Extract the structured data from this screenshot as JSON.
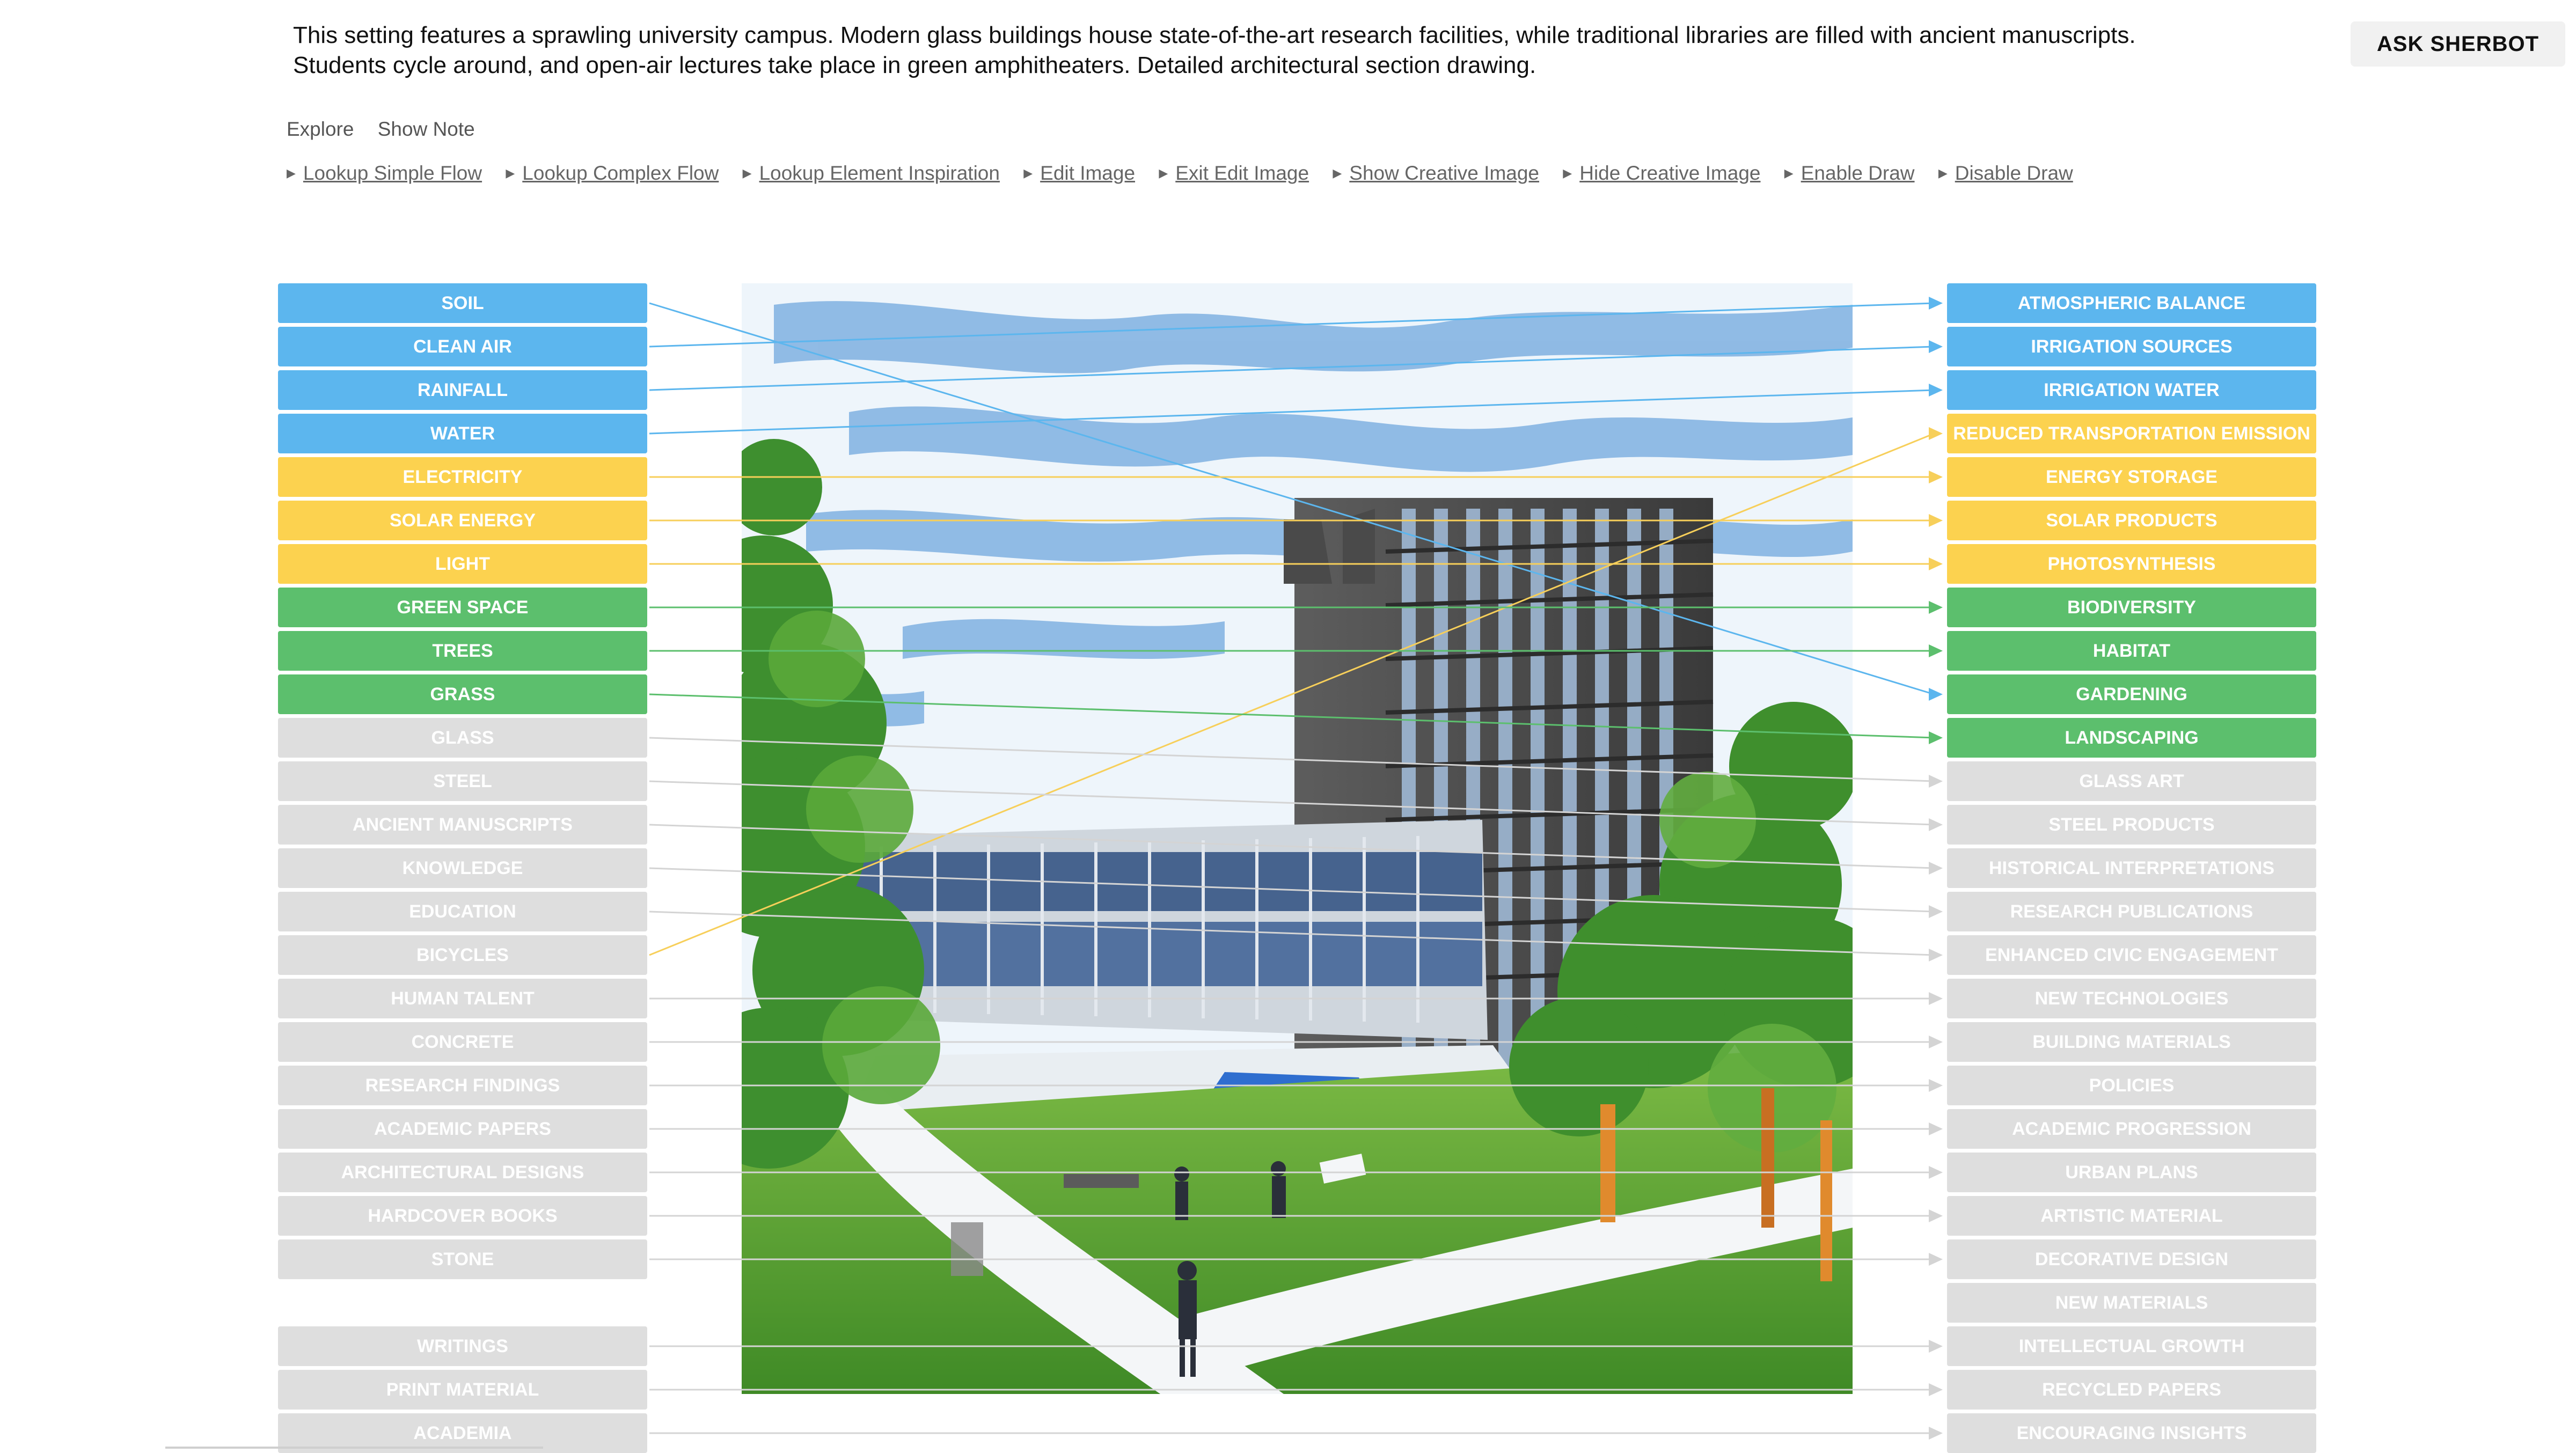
{
  "description": "This setting features a sprawling university campus. Modern glass buildings house state-of-the-art research facilities, while traditional libraries are filled with ancient manuscripts. Students cycle around, and open-air lectures take place in green amphitheaters. Detailed architectural section drawing.",
  "ask_button": "ASK SHERBOT",
  "tabs": [
    "Explore",
    "Show Note"
  ],
  "actions": [
    "Lookup Simple Flow",
    "Lookup Complex Flow",
    "Lookup Element Inspiration",
    "Edit Image",
    "Exit Edit Image",
    "Show Creative Image",
    "Hide Creative Image",
    "Enable Draw",
    "Disable Draw"
  ],
  "colors": {
    "blue": "#5cb6ee",
    "yellow": "#fcd24f",
    "green": "#5cbf6d",
    "gray": "#dedede"
  },
  "inputs": [
    {
      "label": "SOIL",
      "color": "blue"
    },
    {
      "label": "CLEAN AIR",
      "color": "blue"
    },
    {
      "label": "RAINFALL",
      "color": "blue"
    },
    {
      "label": "WATER",
      "color": "blue"
    },
    {
      "label": "ELECTRICITY",
      "color": "yellow"
    },
    {
      "label": "SOLAR ENERGY",
      "color": "yellow"
    },
    {
      "label": "LIGHT",
      "color": "yellow"
    },
    {
      "label": "GREEN SPACE",
      "color": "green"
    },
    {
      "label": "TREES",
      "color": "green"
    },
    {
      "label": "GRASS",
      "color": "green"
    },
    {
      "label": "GLASS",
      "color": "gray"
    },
    {
      "label": "STEEL",
      "color": "gray"
    },
    {
      "label": "ANCIENT MANUSCRIPTS",
      "color": "gray"
    },
    {
      "label": "KNOWLEDGE",
      "color": "gray"
    },
    {
      "label": "EDUCATION",
      "color": "gray"
    },
    {
      "label": "BICYCLES",
      "color": "gray"
    },
    {
      "label": "HUMAN TALENT",
      "color": "gray"
    },
    {
      "label": "CONCRETE",
      "color": "gray"
    },
    {
      "label": "RESEARCH FINDINGS",
      "color": "gray"
    },
    {
      "label": "ACADEMIC PAPERS",
      "color": "gray"
    },
    {
      "label": "ARCHITECTURAL DESIGNS",
      "color": "gray"
    },
    {
      "label": "HARDCOVER BOOKS",
      "color": "gray"
    },
    {
      "label": "STONE",
      "color": "gray"
    },
    {
      "label": "WRITINGS",
      "color": "gray"
    },
    {
      "label": "PRINT MATERIAL",
      "color": "gray"
    },
    {
      "label": "ACADEMIA",
      "color": "gray"
    }
  ],
  "outputs": [
    {
      "label": "ATMOSPHERIC BALANCE",
      "color": "blue"
    },
    {
      "label": "IRRIGATION SOURCES",
      "color": "blue"
    },
    {
      "label": "IRRIGATION WATER",
      "color": "blue"
    },
    {
      "label": "REDUCED TRANSPORTATION EMISSION",
      "color": "yellow"
    },
    {
      "label": "ENERGY STORAGE",
      "color": "yellow"
    },
    {
      "label": "SOLAR PRODUCTS",
      "color": "yellow"
    },
    {
      "label": "PHOTOSYNTHESIS",
      "color": "yellow"
    },
    {
      "label": "BIODIVERSITY",
      "color": "green"
    },
    {
      "label": "HABITAT",
      "color": "green"
    },
    {
      "label": "GARDENING",
      "color": "green"
    },
    {
      "label": "LANDSCAPING",
      "color": "green"
    },
    {
      "label": "GLASS ART",
      "color": "gray"
    },
    {
      "label": "STEEL PRODUCTS",
      "color": "gray"
    },
    {
      "label": "HISTORICAL INTERPRETATIONS",
      "color": "gray"
    },
    {
      "label": "RESEARCH PUBLICATIONS",
      "color": "gray"
    },
    {
      "label": "ENHANCED CIVIC ENGAGEMENT",
      "color": "gray"
    },
    {
      "label": "NEW TECHNOLOGIES",
      "color": "gray"
    },
    {
      "label": "BUILDING MATERIALS",
      "color": "gray"
    },
    {
      "label": "POLICIES",
      "color": "gray"
    },
    {
      "label": "ACADEMIC PROGRESSION",
      "color": "gray"
    },
    {
      "label": "URBAN PLANS",
      "color": "gray"
    },
    {
      "label": "ARTISTIC MATERIAL",
      "color": "gray"
    },
    {
      "label": "DECORATIVE DESIGN",
      "color": "gray"
    },
    {
      "label": "NEW MATERIALS",
      "color": "gray"
    },
    {
      "label": "INTELLECTUAL GROWTH",
      "color": "gray"
    },
    {
      "label": "RECYCLED PAPERS",
      "color": "gray"
    },
    {
      "label": "ENCOURAGING INSIGHTS",
      "color": "gray"
    }
  ],
  "flows": [
    {
      "from": "SOIL",
      "to": "GARDENING",
      "color": "blue"
    },
    {
      "from": "CLEAN AIR",
      "to": "ATMOSPHERIC BALANCE",
      "color": "blue"
    },
    {
      "from": "RAINFALL",
      "to": "IRRIGATION SOURCES",
      "color": "blue"
    },
    {
      "from": "WATER",
      "to": "IRRIGATION WATER",
      "color": "blue"
    },
    {
      "from": "BICYCLES",
      "to": "REDUCED TRANSPORTATION EMISSION",
      "color": "yellow"
    },
    {
      "from": "ELECTRICITY",
      "to": "ENERGY STORAGE",
      "color": "yellow"
    },
    {
      "from": "SOLAR ENERGY",
      "to": "SOLAR PRODUCTS",
      "color": "yellow"
    },
    {
      "from": "LIGHT",
      "to": "PHOTOSYNTHESIS",
      "color": "yellow"
    },
    {
      "from": "GREEN SPACE",
      "to": "BIODIVERSITY",
      "color": "green"
    },
    {
      "from": "TREES",
      "to": "HABITAT",
      "color": "green"
    },
    {
      "from": "GRASS",
      "to": "LANDSCAPING",
      "color": "green"
    },
    {
      "from": "GLASS",
      "to": "GLASS ART",
      "color": "gray"
    },
    {
      "from": "STEEL",
      "to": "STEEL PRODUCTS",
      "color": "gray"
    },
    {
      "from": "ANCIENT MANUSCRIPTS",
      "to": "HISTORICAL INTERPRETATIONS",
      "color": "gray"
    },
    {
      "from": "KNOWLEDGE",
      "to": "RESEARCH PUBLICATIONS",
      "color": "gray"
    },
    {
      "from": "EDUCATION",
      "to": "ENHANCED CIVIC ENGAGEMENT",
      "color": "gray"
    },
    {
      "from": "HUMAN TALENT",
      "to": "NEW TECHNOLOGIES",
      "color": "gray"
    },
    {
      "from": "CONCRETE",
      "to": "BUILDING MATERIALS",
      "color": "gray"
    },
    {
      "from": "RESEARCH FINDINGS",
      "to": "POLICIES",
      "color": "gray"
    },
    {
      "from": "ACADEMIC PAPERS",
      "to": "ACADEMIC PROGRESSION",
      "color": "gray"
    },
    {
      "from": "ARCHITECTURAL DESIGNS",
      "to": "URBAN PLANS",
      "color": "gray"
    },
    {
      "from": "HARDCOVER BOOKS",
      "to": "ARTISTIC MATERIAL",
      "color": "gray"
    },
    {
      "from": "STONE",
      "to": "DECORATIVE DESIGN",
      "color": "gray"
    },
    {
      "from": "WRITINGS",
      "to": "INTELLECTUAL GROWTH",
      "color": "gray"
    },
    {
      "from": "PRINT MATERIAL",
      "to": "RECYCLED PAPERS",
      "color": "gray"
    },
    {
      "from": "ACADEMIA",
      "to": "ENCOURAGING INSIGHTS",
      "color": "gray"
    }
  ]
}
